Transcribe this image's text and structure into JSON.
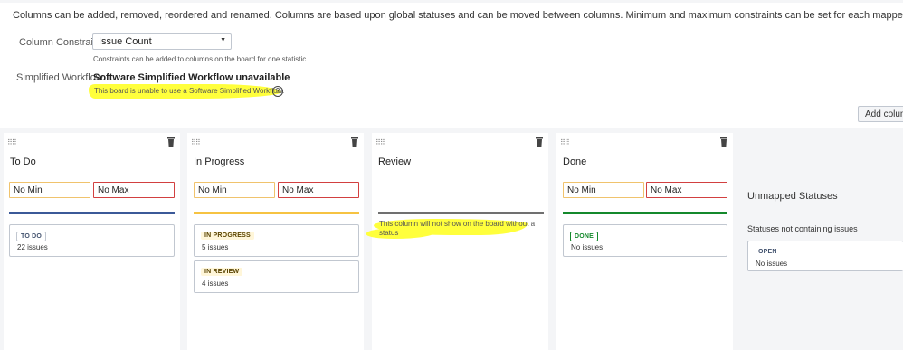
{
  "intro_text": "Columns can be added, removed, reordered and renamed. Columns are based upon global statuses and can be moved between columns. Minimum and maximum constraints can be set for each mapped column.",
  "column_constraint": {
    "label": "Column Constraint",
    "selected": "Issue Count",
    "hint": "Constraints can be added to columns on the board for one statistic."
  },
  "simplified_workflow": {
    "label": "Simplified Workflow",
    "title": "Software Simplified Workflow unavailable",
    "note": "This board is unable to use a Software Simplified Workflow."
  },
  "add_column_label": "Add colum",
  "columns": [
    {
      "title": "To Do",
      "min_placeholder": "No Min",
      "max_placeholder": "No Max",
      "bar_color": "#3b5998",
      "cards": [
        {
          "status": "TO DO",
          "count": "22 issues"
        }
      ]
    },
    {
      "title": "In Progress",
      "min_placeholder": "No Min",
      "max_placeholder": "No Max",
      "bar_color": "#f6c342",
      "cards": [
        {
          "status": "IN PROGRESS",
          "count": "5 issues"
        },
        {
          "status": "IN REVIEW",
          "count": "4 issues"
        }
      ]
    },
    {
      "title": "Review",
      "bar_color": "#707070",
      "empty_note": "This column will not show on the board without a status"
    },
    {
      "title": "Done",
      "min_placeholder": "No Min",
      "max_placeholder": "No Max",
      "bar_color": "#14892c",
      "cards": [
        {
          "status": "DONE",
          "count": "No issues"
        }
      ]
    }
  ],
  "unmapped": {
    "title": "Unmapped Statuses",
    "subtitle": "Statuses not containing issues",
    "cards": [
      {
        "status": "OPEN",
        "count": "No issues"
      }
    ]
  },
  "icons": {
    "grip": "drag-handle-icon",
    "trash": "trash-icon",
    "help": "question-circle-icon",
    "caret": "chevron-down-icon"
  },
  "colors": {
    "highlight": "#ffff3c",
    "min_border": "#f0c36d",
    "max_border": "#d24040"
  }
}
